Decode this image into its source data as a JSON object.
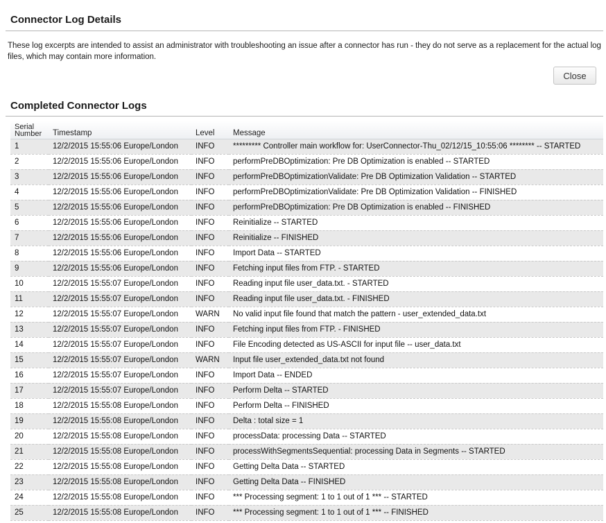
{
  "page": {
    "title": "Connector Log Details",
    "description": "These log excerpts are intended to assist an administrator with troubleshooting an issue after a connector has run - they do not serve as a replacement for the actual log files, which may contain more information.",
    "close_label": "Close"
  },
  "logs": {
    "title": "Completed Connector Logs",
    "columns": {
      "serial_line1": "Serial",
      "serial_line2": "Number",
      "timestamp": "Timestamp",
      "level": "Level",
      "message": "Message"
    },
    "rows": [
      {
        "serial": "1",
        "timestamp": "12/2/2015 15:55:06 Europe/London",
        "level": "INFO",
        "message": "********* Controller main workflow for: UserConnector-Thu_02/12/15_10:55:06 ******** -- STARTED"
      },
      {
        "serial": "2",
        "timestamp": "12/2/2015 15:55:06 Europe/London",
        "level": "INFO",
        "message": "performPreDBOptimization: Pre DB Optimization is enabled -- STARTED"
      },
      {
        "serial": "3",
        "timestamp": "12/2/2015 15:55:06 Europe/London",
        "level": "INFO",
        "message": "performPreDBOptimizationValidate: Pre DB Optimization Validation -- STARTED"
      },
      {
        "serial": "4",
        "timestamp": "12/2/2015 15:55:06 Europe/London",
        "level": "INFO",
        "message": "performPreDBOptimizationValidate: Pre DB Optimization Validation -- FINISHED"
      },
      {
        "serial": "5",
        "timestamp": "12/2/2015 15:55:06 Europe/London",
        "level": "INFO",
        "message": "performPreDBOptimization: Pre DB Optimization is enabled -- FINISHED"
      },
      {
        "serial": "6",
        "timestamp": "12/2/2015 15:55:06 Europe/London",
        "level": "INFO",
        "message": "Reinitialize -- STARTED"
      },
      {
        "serial": "7",
        "timestamp": "12/2/2015 15:55:06 Europe/London",
        "level": "INFO",
        "message": "Reinitialize -- FINISHED"
      },
      {
        "serial": "8",
        "timestamp": "12/2/2015 15:55:06 Europe/London",
        "level": "INFO",
        "message": "Import Data -- STARTED"
      },
      {
        "serial": "9",
        "timestamp": "12/2/2015 15:55:06 Europe/London",
        "level": "INFO",
        "message": "Fetching input files from FTP. - STARTED"
      },
      {
        "serial": "10",
        "timestamp": "12/2/2015 15:55:07 Europe/London",
        "level": "INFO",
        "message": "Reading input file user_data.txt. - STARTED"
      },
      {
        "serial": "11",
        "timestamp": "12/2/2015 15:55:07 Europe/London",
        "level": "INFO",
        "message": "Reading input file user_data.txt. - FINISHED"
      },
      {
        "serial": "12",
        "timestamp": "12/2/2015 15:55:07 Europe/London",
        "level": "WARN",
        "message": "No valid input file found that match the pattern - user_extended_data.txt"
      },
      {
        "serial": "13",
        "timestamp": "12/2/2015 15:55:07 Europe/London",
        "level": "INFO",
        "message": "Fetching input files from FTP. - FINISHED"
      },
      {
        "serial": "14",
        "timestamp": "12/2/2015 15:55:07 Europe/London",
        "level": "INFO",
        "message": "File Encoding detected as US-ASCII for input file -- user_data.txt"
      },
      {
        "serial": "15",
        "timestamp": "12/2/2015 15:55:07 Europe/London",
        "level": "WARN",
        "message": "Input file user_extended_data.txt not found"
      },
      {
        "serial": "16",
        "timestamp": "12/2/2015 15:55:07 Europe/London",
        "level": "INFO",
        "message": "Import Data -- ENDED"
      },
      {
        "serial": "17",
        "timestamp": "12/2/2015 15:55:07 Europe/London",
        "level": "INFO",
        "message": "Perform Delta -- STARTED"
      },
      {
        "serial": "18",
        "timestamp": "12/2/2015 15:55:08 Europe/London",
        "level": "INFO",
        "message": "Perform Delta -- FINISHED"
      },
      {
        "serial": "19",
        "timestamp": "12/2/2015 15:55:08 Europe/London",
        "level": "INFO",
        "message": "Delta : total size = 1"
      },
      {
        "serial": "20",
        "timestamp": "12/2/2015 15:55:08 Europe/London",
        "level": "INFO",
        "message": "processData: processing Data -- STARTED"
      },
      {
        "serial": "21",
        "timestamp": "12/2/2015 15:55:08 Europe/London",
        "level": "INFO",
        "message": "processWithSegmentsSequential: processing Data in Segments -- STARTED"
      },
      {
        "serial": "22",
        "timestamp": "12/2/2015 15:55:08 Europe/London",
        "level": "INFO",
        "message": "Getting Delta Data -- STARTED"
      },
      {
        "serial": "23",
        "timestamp": "12/2/2015 15:55:08 Europe/London",
        "level": "INFO",
        "message": "Getting Delta Data -- FINISHED"
      },
      {
        "serial": "24",
        "timestamp": "12/2/2015 15:55:08 Europe/London",
        "level": "INFO",
        "message": "*** Processing segment: 1 to 1 out of 1 *** -- STARTED"
      },
      {
        "serial": "25",
        "timestamp": "12/2/2015 15:55:08 Europe/London",
        "level": "INFO",
        "message": "*** Processing segment: 1 to 1 out of 1 *** -- FINISHED"
      }
    ]
  }
}
